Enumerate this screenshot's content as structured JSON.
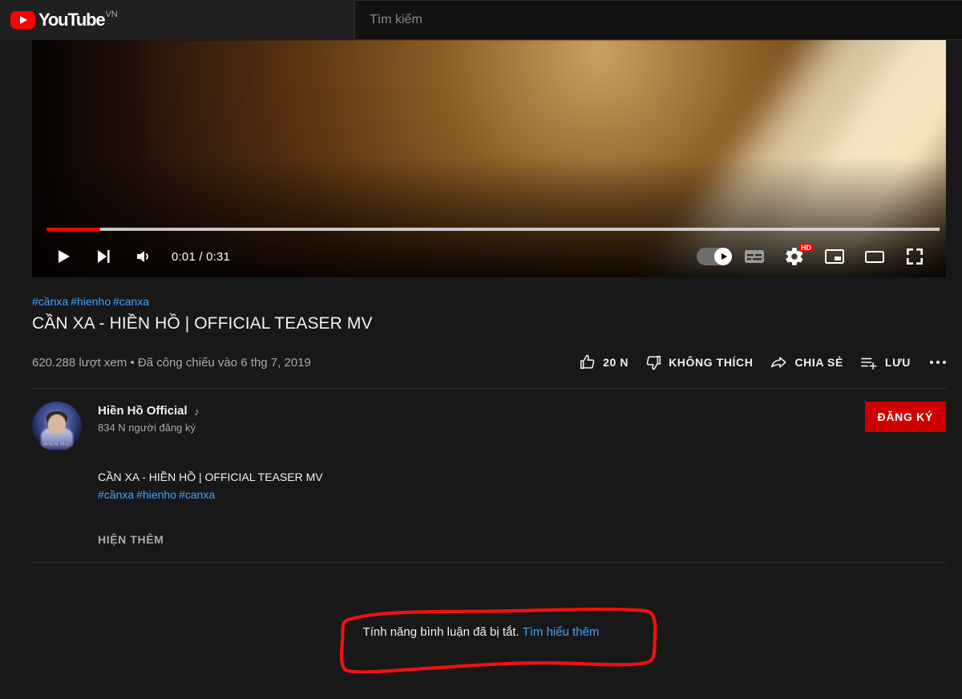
{
  "header": {
    "logo_text": "YouTube",
    "logo_icon": "youtube-play-icon",
    "country_code": "VN",
    "search": {
      "placeholder": "Tìm kiếm",
      "value": ""
    }
  },
  "player": {
    "current_time": "0:01",
    "duration": "0:31",
    "time_display": "0:01 / 0:31",
    "progress_percent": 6,
    "buffered_percent": 100,
    "play_icon": "play-icon",
    "next_icon": "next-track-icon",
    "volume_icon": "volume-on-icon",
    "autoplay_icon": "autoplay-toggle-on",
    "subtitles_icon": "subtitles-icon",
    "settings_icon": "gear-icon",
    "quality_badge": "HD",
    "miniplayer_icon": "miniplayer-icon",
    "theater_icon": "theater-mode-icon",
    "fullscreen_icon": "fullscreen-icon",
    "accent_color": "#ff0000"
  },
  "video": {
    "hashtags": [
      "#cầnxa",
      "#hienho",
      "#canxa"
    ],
    "title": "CẦN XA - HIỀN HỒ | OFFICIAL TEASER MV",
    "views_and_date": "620.288 lượt xem • Đã công chiếu vào 6 thg 7, 2019"
  },
  "actions": {
    "like": {
      "label": "20 N",
      "icon": "thumbs-up-icon"
    },
    "dislike": {
      "label": "KHÔNG THÍCH",
      "icon": "thumbs-down-icon"
    },
    "share": {
      "label": "CHIA SẺ",
      "icon": "share-arrow-icon"
    },
    "save": {
      "label": "LƯU",
      "icon": "save-to-playlist-icon"
    },
    "more": {
      "label": "",
      "icon": "more-horizontal-icon"
    }
  },
  "channel": {
    "name": "Hiền Hồ Official",
    "verified_badge": "♪",
    "subscribers": "834 N người đăng ký",
    "subscribe_label": "ĐĂNG KÝ",
    "subscribe_color": "#cc0000",
    "avatar_caption": "HIEN HO"
  },
  "description": {
    "line": "CẦN XA - HIỀN HỒ | OFFICIAL TEASER MV",
    "hashtags": [
      "#cầnxa",
      "#hienho",
      "#canxa"
    ],
    "show_more_label": "HIỆN THÊM"
  },
  "comments": {
    "disabled_text": "Tính năng bình luận đã bị tắt.",
    "learn_more_label": "Tìm hiểu thêm",
    "link_color": "#3ea6ff"
  },
  "annotation": {
    "type": "hand-drawn-rectangle",
    "color": "#ee1111"
  }
}
